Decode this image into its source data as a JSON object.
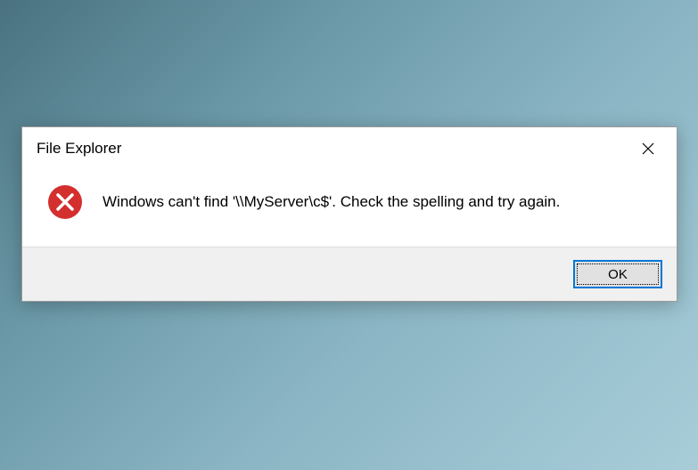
{
  "dialog": {
    "title": "File Explorer",
    "message": "Windows can't find '\\\\MyServer\\c$'. Check the spelling and try again.",
    "ok_label": "OK"
  }
}
